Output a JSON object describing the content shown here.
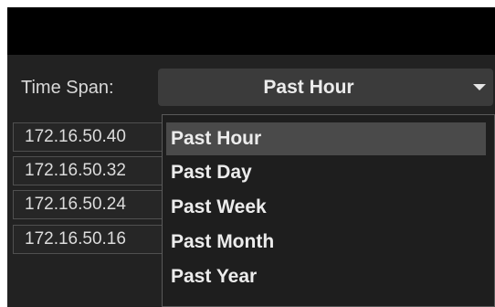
{
  "filter": {
    "label": "Time Span:",
    "selected": "Past Hour"
  },
  "dropdown": {
    "options": [
      "Past Hour",
      "Past Day",
      "Past Week",
      "Past Month",
      "Past Year"
    ]
  },
  "hosts": [
    "172.16.50.40",
    "172.16.50.32",
    "172.16.50.24",
    "172.16.50.16"
  ]
}
